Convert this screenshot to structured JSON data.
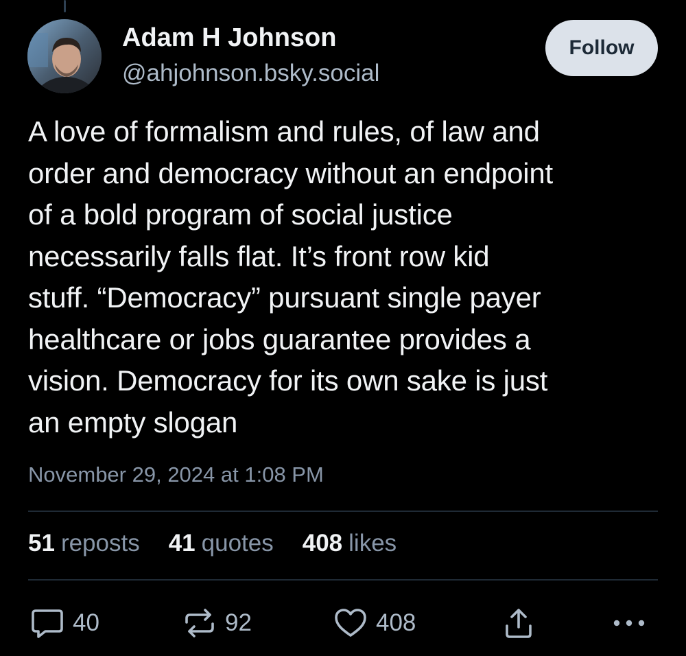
{
  "author": {
    "display_name": "Adam H Johnson",
    "handle": "@ahjohnson.bsky.social"
  },
  "follow_button": {
    "label": "Follow"
  },
  "post": {
    "text_lines": [
      "A love of formalism and rules, of law and",
      "order and democracy without an endpoint",
      "of a bold program of social justice",
      "necessarily falls flat. It’s front row kid",
      "stuff. “Democracy” pursuant single payer",
      "healthcare or jobs guarantee provides a",
      "vision. Democracy for its own sake is just",
      "an empty slogan"
    ],
    "timestamp": "November 29, 2024 at 1:08 PM"
  },
  "stats": {
    "reposts": {
      "count": "51",
      "label": "reposts"
    },
    "quotes": {
      "count": "41",
      "label": "quotes"
    },
    "likes": {
      "count": "408",
      "label": "likes"
    }
  },
  "actions": {
    "reply": {
      "icon": "reply-icon",
      "count": "40"
    },
    "repost": {
      "icon": "repost-icon",
      "count": "92"
    },
    "like": {
      "icon": "heart-icon",
      "count": "408"
    },
    "share": {
      "icon": "share-icon"
    },
    "more": {
      "icon": "more-icon"
    }
  },
  "colors": {
    "background": "#000000",
    "primary_text": "#f1f3f5",
    "secondary_text": "#8896a8",
    "follow_button_bg": "#dce2ea",
    "divider": "#1f2a35"
  }
}
